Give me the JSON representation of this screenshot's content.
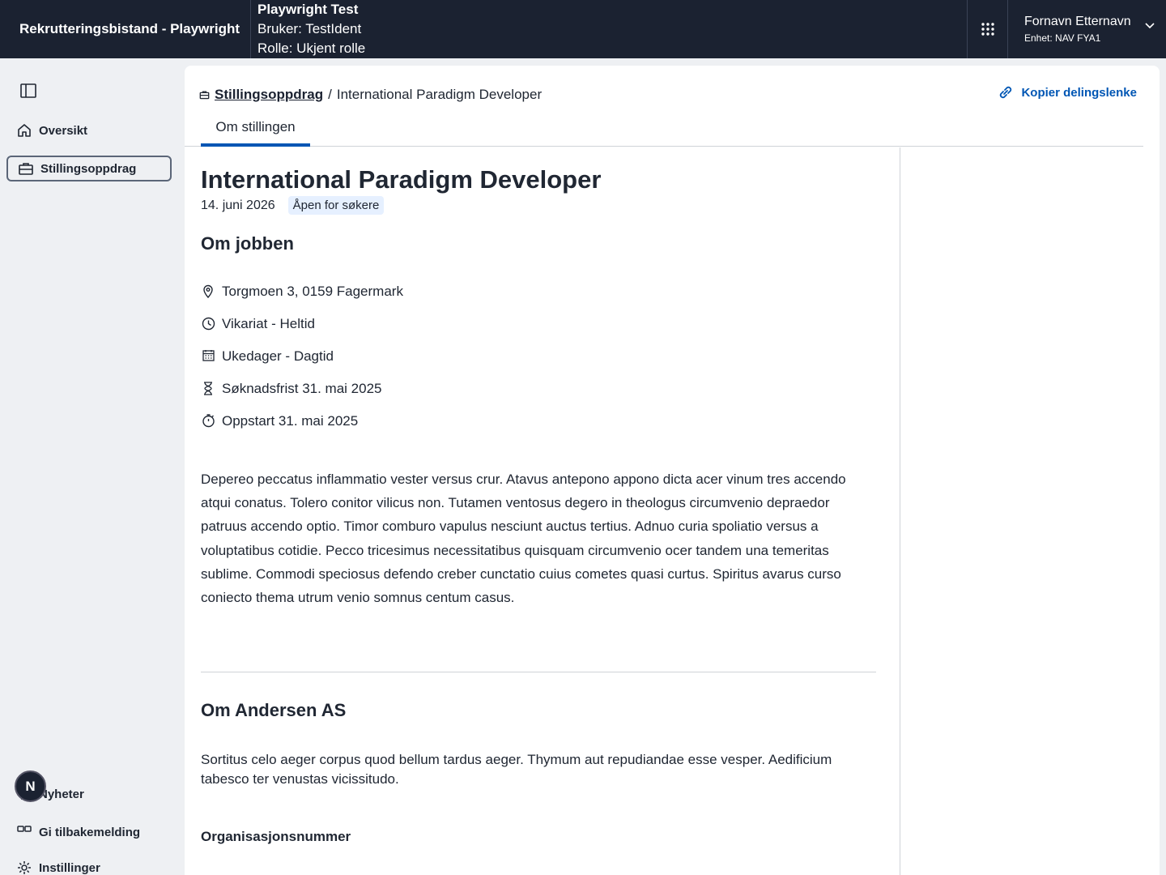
{
  "header": {
    "app_title": "Rekrutteringsbistand - Playwright",
    "env_title": "Playwright Test",
    "env_user": "Bruker: TestIdent",
    "env_role": "Rolle: Ukjent rolle",
    "user_name": "Fornavn Etternavn",
    "user_unit": "Enhet: NAV FYA1"
  },
  "sidebar": {
    "items": [
      {
        "label": "Oversikt",
        "icon": "house-icon"
      },
      {
        "label": "Stillingsoppdrag",
        "icon": "briefcase-icon",
        "active": true
      }
    ],
    "bottom_items": [
      {
        "label": "Nyheter",
        "icon": "megaphone-icon"
      },
      {
        "label": "Gi tilbakemelding",
        "icon": "feedback-icon"
      },
      {
        "label": "Instillinger",
        "icon": "gear-icon"
      }
    ],
    "avatar_letter": "N"
  },
  "breadcrumb": {
    "parent": "Stillingsoppdrag",
    "separator": "/",
    "current": "International Paradigm Developer"
  },
  "share_label": "Kopier delingslenke",
  "tabs": [
    {
      "label": "Om stillingen",
      "selected": true
    }
  ],
  "job": {
    "title": "International Paradigm Developer",
    "date": "14. juni 2026",
    "status": "Åpen for søkere",
    "section_title": "Om jobben",
    "facts": [
      {
        "icon": "location-pin-icon",
        "text": "Torgmoen 3, 0159 Fagermark"
      },
      {
        "icon": "clock-icon",
        "text": "Vikariat - Heltid"
      },
      {
        "icon": "calendar-icon",
        "text": "Ukedager - Dagtid"
      },
      {
        "icon": "hourglass-icon",
        "text": "Søknadsfrist 31. mai 2025"
      },
      {
        "icon": "stopwatch-icon",
        "text": "Oppstart 31. mai 2025"
      }
    ],
    "description": "Depereo peccatus inflammatio vester versus crur. Atavus antepono appono dicta acer vinum tres accendo atqui conatus. Tolero conitor vilicus non. Tutamen ventosus degero in theologus circumvenio depraedor patruus accendo optio. Timor comburo vapulus nesciunt auctus tertius. Adnuo curia spoliatio versus a voluptatibus cotidie. Pecco tricesimus necessitatibus quisquam circumvenio ocer tandem una temeritas sublime. Commodi speciosus defendo creber cunctatio cuius cometes quasi curtus. Spiritus avarus curso coniecto thema utrum venio somnus centum casus."
  },
  "company": {
    "section_title": "Om Andersen AS",
    "description": "Sortitus celo aeger corpus quod bellum tardus aeger. Thymum aut repudiandae esse vesper. Aedificium tabesco ter venustas vicissitudo.",
    "org_label": "Organisasjonsnummer"
  },
  "colors": {
    "header_bg": "#1b2231",
    "accent": "#0056b4",
    "page_bg": "#eef0f3",
    "badge_bg": "#e6f0ff"
  }
}
